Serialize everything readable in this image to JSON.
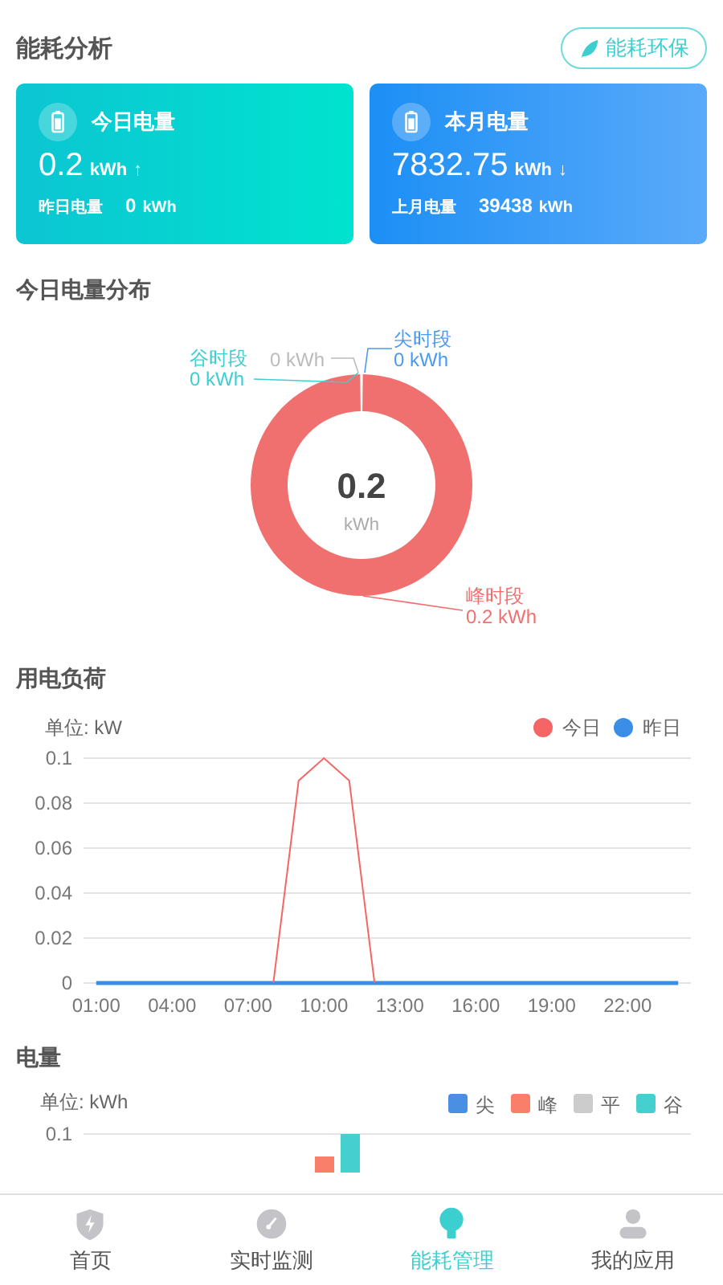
{
  "header": {
    "title": "能耗分析",
    "button": "能耗环保"
  },
  "cards": [
    {
      "kind": "today",
      "title": "今日电量",
      "value": "0.2",
      "unit": "kWh",
      "arrow": "↑",
      "compare_label": "昨日电量",
      "compare_value": "0",
      "compare_unit": "kWh"
    },
    {
      "kind": "month",
      "title": "本月电量",
      "value": "7832.75",
      "unit": "kWh",
      "arrow": "↓",
      "compare_label": "上月电量",
      "compare_value": "39438",
      "compare_unit": "kWh"
    }
  ],
  "distribution": {
    "title": "今日电量分布",
    "center_value": "0.2",
    "center_unit": "kWh",
    "chart_data": {
      "type": "donut",
      "categories": [
        "谷时段",
        null,
        "尖时段",
        "峰时段"
      ],
      "values": [
        0,
        0,
        0,
        100
      ]
    },
    "callouts": [
      {
        "reading": "0 kWh",
        "color": "#3ccfcf"
      },
      {
        "reading": "0 kWh",
        "color": "#bbbbbb"
      },
      {
        "reading": "0 kWh",
        "color": "#4a9bf0"
      },
      {
        "reading": "0.2 kWh",
        "color": "#f07070"
      }
    ]
  },
  "load": {
    "title": "用电负荷",
    "unit": "单位: kW",
    "chart_data": {
      "type": "line",
      "x": [
        1,
        2,
        3,
        4,
        5,
        6,
        7,
        8,
        9,
        10,
        11,
        12,
        13,
        14,
        15,
        16,
        17,
        18,
        19,
        20,
        21,
        22,
        23,
        24
      ],
      "series": [
        {
          "name": "今日",
          "color": "#f56565",
          "values": [
            null,
            null,
            null,
            null,
            null,
            null,
            null,
            0,
            0.09,
            0.1,
            0.09,
            0,
            null,
            null,
            null,
            null,
            null,
            null,
            null,
            null,
            null,
            null,
            null,
            null
          ]
        },
        {
          "name": "昨日",
          "color": "#3a8ee6",
          "values": [
            0,
            0,
            0,
            0,
            0,
            0,
            0,
            0,
            0,
            0,
            0,
            0,
            0,
            0,
            0,
            0,
            0,
            0,
            0,
            0,
            0,
            0,
            0,
            0
          ]
        }
      ],
      "xlim": [
        0.5,
        24.5
      ],
      "ylim": [
        0,
        0.1
      ],
      "grid": true,
      "legend": true,
      "yticks": [
        0,
        0.02,
        0.04,
        0.06,
        0.08,
        0.1
      ],
      "xticks": [
        {
          "value": 1,
          "label": "01:00"
        },
        {
          "value": 4,
          "label": "04:00"
        },
        {
          "value": 7,
          "label": "07:00"
        },
        {
          "value": 10,
          "label": "10:00"
        },
        {
          "value": 13,
          "label": "13:00"
        },
        {
          "value": 16,
          "label": "16:00"
        },
        {
          "value": 19,
          "label": "19:00"
        },
        {
          "value": 22,
          "label": "22:00"
        }
      ]
    }
  },
  "energy": {
    "title": "电量",
    "unit": "单位: kWh",
    "ytick": "0.1",
    "legend": [
      {
        "label": "尖",
        "color": "#4a90e2"
      },
      {
        "label": "峰",
        "color": "#fa7f6a"
      },
      {
        "label": "平",
        "color": "#cccccc"
      },
      {
        "label": "谷",
        "color": "#45cfcf"
      }
    ]
  },
  "nav": [
    {
      "kind": "home",
      "label": "首页",
      "selected": false
    },
    {
      "kind": "monitor",
      "label": "实时监测",
      "selected": false
    },
    {
      "kind": "energy",
      "label": "能耗管理",
      "selected": true
    },
    {
      "kind": "apps",
      "label": "我的应用",
      "selected": false
    }
  ]
}
